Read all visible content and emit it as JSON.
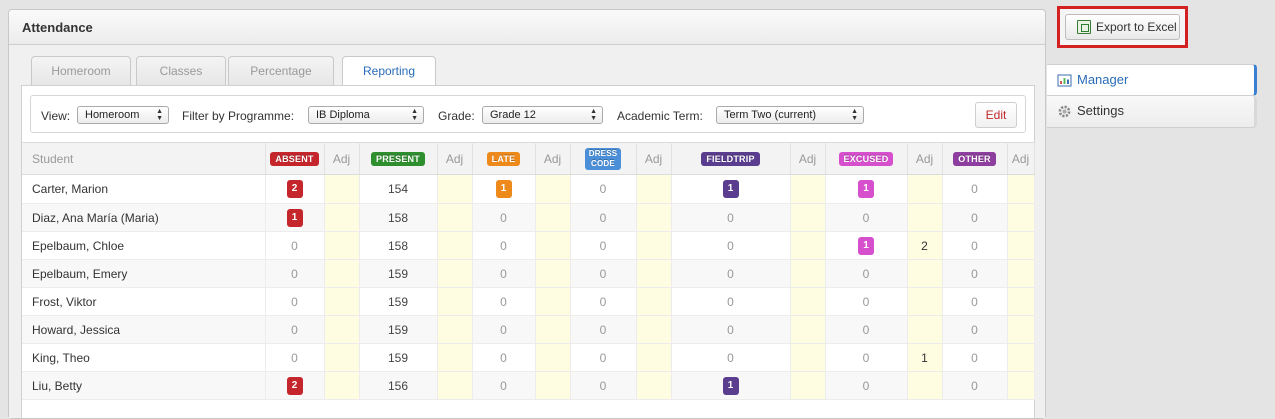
{
  "panel": {
    "title": "Attendance"
  },
  "tabs": [
    {
      "label": "Homeroom"
    },
    {
      "label": "Classes"
    },
    {
      "label": "Percentage"
    },
    {
      "label": "Reporting",
      "active": true
    }
  ],
  "filters": {
    "view_label": "View:",
    "view_value": "Homeroom",
    "programme_label": "Filter by Programme:",
    "programme_value": "IB Diploma",
    "grade_label": "Grade:",
    "grade_value": "Grade 12",
    "term_label": "Academic Term:",
    "term_value": "Term Two (current)",
    "edit_label": "Edit"
  },
  "export": {
    "label": "Export to Excel",
    "icon": "excel-icon"
  },
  "side_nav": {
    "items": [
      {
        "label": "Manager",
        "icon": "manager-icon",
        "active": true
      },
      {
        "label": "Settings",
        "icon": "gear-icon"
      }
    ]
  },
  "table": {
    "student_header": "Student",
    "adj_header": "Adj",
    "statuses": [
      {
        "key": "absent",
        "label": "ABSENT",
        "color": "#c4262b"
      },
      {
        "key": "present",
        "label": "PRESENT",
        "color": "#2f8f2f"
      },
      {
        "key": "late",
        "label": "LATE",
        "color": "#ee8a1c"
      },
      {
        "key": "dress",
        "label": "DRESS",
        "label2": "CODE",
        "color": "#4a8fd8"
      },
      {
        "key": "fieldtrip",
        "label": "FIELDTRIP",
        "color": "#5b3d8f"
      },
      {
        "key": "excused",
        "label": "EXCUSED",
        "color": "#d64fcc"
      },
      {
        "key": "other",
        "label": "OTHER",
        "color": "#8e3e9e"
      }
    ],
    "rows": [
      {
        "name": "Carter, Marion",
        "values": [
          "2",
          "154",
          "1",
          "0",
          "1",
          "1",
          "0"
        ],
        "adj": [
          "",
          "",
          "",
          "",
          "",
          "",
          ""
        ]
      },
      {
        "name": "Diaz, Ana María (Maria)",
        "values": [
          "1",
          "158",
          "0",
          "0",
          "0",
          "0",
          "0"
        ],
        "adj": [
          "",
          "",
          "",
          "",
          "",
          "",
          ""
        ]
      },
      {
        "name": "Epelbaum, Chloe",
        "values": [
          "0",
          "158",
          "0",
          "0",
          "0",
          "1",
          "0"
        ],
        "adj": [
          "",
          "",
          "",
          "",
          "",
          "2",
          ""
        ]
      },
      {
        "name": "Epelbaum, Emery",
        "values": [
          "0",
          "159",
          "0",
          "0",
          "0",
          "0",
          "0"
        ],
        "adj": [
          "",
          "",
          "",
          "",
          "",
          "",
          ""
        ]
      },
      {
        "name": "Frost, Viktor",
        "values": [
          "0",
          "159",
          "0",
          "0",
          "0",
          "0",
          "0"
        ],
        "adj": [
          "",
          "",
          "",
          "",
          "",
          "",
          ""
        ]
      },
      {
        "name": "Howard, Jessica",
        "values": [
          "0",
          "159",
          "0",
          "0",
          "0",
          "0",
          "0"
        ],
        "adj": [
          "",
          "",
          "",
          "",
          "",
          "",
          ""
        ]
      },
      {
        "name": "King, Theo",
        "values": [
          "0",
          "159",
          "0",
          "0",
          "0",
          "0",
          "0"
        ],
        "adj": [
          "",
          "",
          "",
          "",
          "",
          "1",
          ""
        ]
      },
      {
        "name": "Liu, Betty",
        "values": [
          "2",
          "156",
          "0",
          "0",
          "1",
          "0",
          "0"
        ],
        "adj": [
          "",
          "",
          "",
          "",
          "",
          "",
          ""
        ]
      }
    ]
  }
}
